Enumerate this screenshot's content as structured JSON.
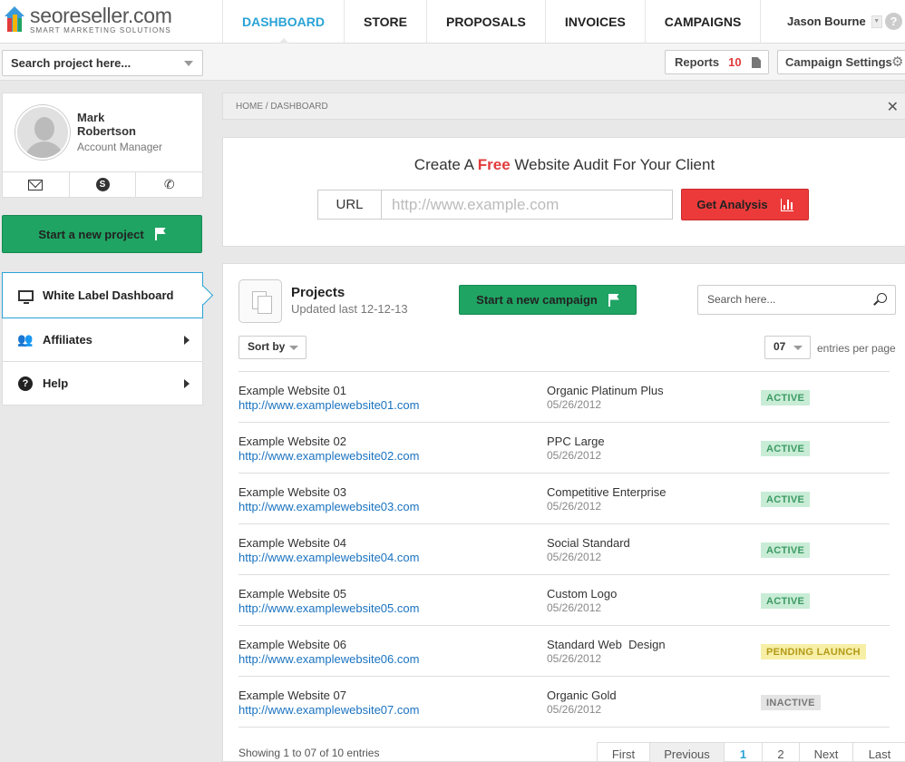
{
  "brand": {
    "name": "seoreseller.com",
    "tagline": "SMART MARKETING SOLUTIONS"
  },
  "nav": {
    "items": [
      {
        "label": "DASHBOARD",
        "active": true
      },
      {
        "label": "STORE"
      },
      {
        "label": "PROPOSALS"
      },
      {
        "label": "INVOICES"
      },
      {
        "label": "CAMPAIGNS"
      }
    ],
    "user_name": "Jason Bourne",
    "help_glyph": "?"
  },
  "subbar": {
    "search_placeholder": "Search project here...",
    "reports_label": "Reports",
    "reports_count": "10",
    "settings_label": "Campaign Settings"
  },
  "profile": {
    "first_name": "Mark",
    "last_name": "Robertson",
    "role": "Account Manager"
  },
  "sidebar": {
    "new_project_label": "Start a new project",
    "items": [
      {
        "label": "White Label Dashboard",
        "active": true
      },
      {
        "label": "Affiliates"
      },
      {
        "label": "Help"
      }
    ]
  },
  "breadcrumb": "HOME / DASHBOARD",
  "audit": {
    "title_before": "Create A ",
    "title_highlight": "Free",
    "title_after": " Website Audit For Your Client",
    "url_label": "URL",
    "url_placeholder": "http://www.example.com",
    "button_label": "Get Analysis"
  },
  "projects": {
    "title": "Projects",
    "updated": "Updated last 12-12-13",
    "campaign_button": "Start a new campaign",
    "search_placeholder": "Search here...",
    "sort_label": "Sort by",
    "entries_value": "07",
    "entries_label": "entries per page",
    "rows": [
      {
        "name": "Example Website 01",
        "url": "http://www.examplewebsite01.com",
        "plan": "Organic Platinum Plus",
        "date": "05/26/2012",
        "status": "ACTIVE"
      },
      {
        "name": "Example Website 02",
        "url": "http://www.examplewebsite02.com",
        "plan": "PPC Large",
        "date": "05/26/2012",
        "status": "ACTIVE"
      },
      {
        "name": "Example Website 03",
        "url": "http://www.examplewebsite03.com",
        "plan": "Competitive Enterprise",
        "date": "05/26/2012",
        "status": "ACTIVE"
      },
      {
        "name": "Example Website 04",
        "url": "http://www.examplewebsite04.com",
        "plan": "Social Standard",
        "date": "05/26/2012",
        "status": "ACTIVE"
      },
      {
        "name": "Example Website 05",
        "url": "http://www.examplewebsite05.com",
        "plan": "Custom Logo",
        "date": "05/26/2012",
        "status": "ACTIVE"
      },
      {
        "name": "Example Website 06",
        "url": "http://www.examplewebsite06.com",
        "plan": "Standard Web  Design",
        "date": "05/26/2012",
        "status": "PENDING LAUNCH"
      },
      {
        "name": "Example Website 07",
        "url": "http://www.examplewebsite07.com",
        "plan": "Organic Gold",
        "date": "05/26/2012",
        "status": "INACTIVE"
      }
    ],
    "showing": "Showing 1 to 07 of 10 entries",
    "pager": {
      "first": "First",
      "previous": "Previous",
      "page1": "1",
      "page2": "2",
      "next": "Next",
      "last": "Last"
    }
  },
  "colors": {
    "accent": "#2aa3d6",
    "green": "#1fa463",
    "red": "#ec3a3a"
  }
}
